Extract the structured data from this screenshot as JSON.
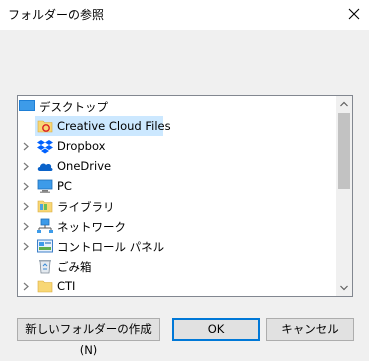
{
  "window": {
    "title": "フォルダーの参照"
  },
  "tree": {
    "root": {
      "label": "デスクトップ",
      "icon": "desktop-icon"
    },
    "items": [
      {
        "label": "Creative Cloud Files",
        "icon": "creative-cloud-folder-icon",
        "expandable": false,
        "selected": true
      },
      {
        "label": "Dropbox",
        "icon": "dropbox-icon",
        "expandable": true
      },
      {
        "label": "OneDrive",
        "icon": "onedrive-icon",
        "expandable": true
      },
      {
        "label": "PC",
        "icon": "pc-icon",
        "expandable": true
      },
      {
        "label": "ライブラリ",
        "icon": "library-icon",
        "expandable": true
      },
      {
        "label": "ネットワーク",
        "icon": "network-icon",
        "expandable": true
      },
      {
        "label": "コントロール パネル",
        "icon": "control-panel-icon",
        "expandable": true
      },
      {
        "label": "ごみ箱",
        "icon": "recycle-bin-icon",
        "expandable": false
      },
      {
        "label": "CTI",
        "icon": "folder-icon",
        "expandable": true
      }
    ]
  },
  "buttons": {
    "new_folder": "新しいフォルダーの作成(N)",
    "ok": "OK",
    "cancel": "キャンセル"
  },
  "colors": {
    "selection": "#cce8ff",
    "default_button_border": "#0078d7",
    "folder": "#f8d775"
  }
}
